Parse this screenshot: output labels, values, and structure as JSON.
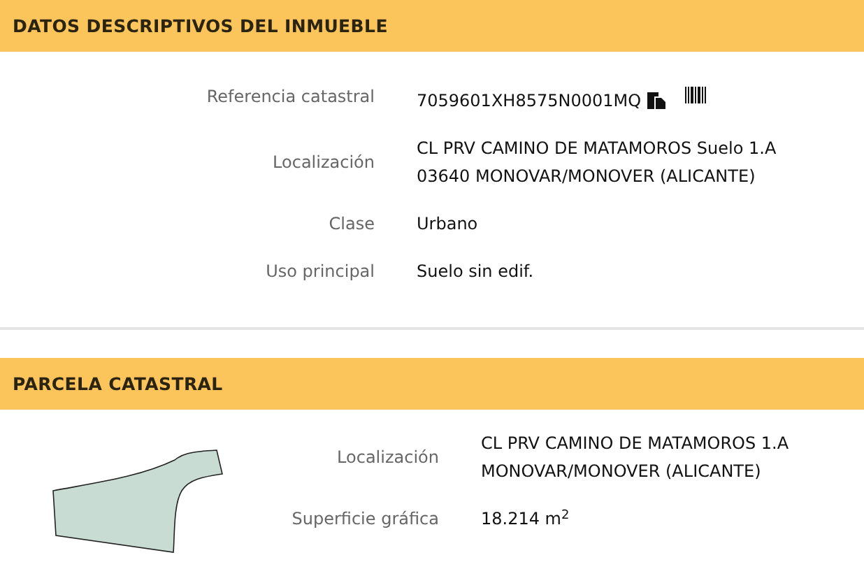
{
  "sections": [
    {
      "title": "DATOS DESCRIPTIVOS DEL INMUEBLE",
      "rows": [
        {
          "label": "Referencia catastral",
          "value": "7059601XH8575N0001MQ",
          "kind": "reference"
        },
        {
          "label": "Localización",
          "lines": [
            "CL PRV CAMINO DE MATAMOROS Suelo 1.A",
            "03640 MONOVAR/MONOVER (ALICANTE)"
          ],
          "kind": "text"
        },
        {
          "label": "Clase",
          "value": "Urbano",
          "kind": "text"
        },
        {
          "label": "Uso principal",
          "value": "Suelo sin edif.",
          "kind": "text"
        }
      ]
    },
    {
      "title": "PARCELA CATASTRAL",
      "rows": [
        {
          "label": "Localización",
          "lines": [
            "CL PRV CAMINO DE MATAMOROS 1.A",
            "MONOVAR/MONOVER (ALICANTE)"
          ],
          "kind": "text"
        },
        {
          "label": "Superficie gráfica",
          "value": "18.214 m$^{2}$",
          "kind": "text"
        }
      ]
    }
  ]
}
